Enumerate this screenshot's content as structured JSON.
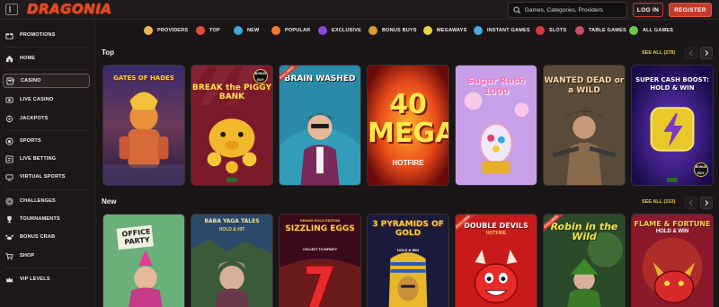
{
  "header": {
    "logo": "DRAGONIA",
    "search_placeholder": "Games, Categories, Providers",
    "login_label": "LOG IN",
    "register_label": "REGISTER"
  },
  "sidebar": {
    "items": [
      {
        "label": "PROMOTIONS",
        "icon": "gift-icon"
      },
      {
        "label": "HOME",
        "icon": "home-icon"
      },
      {
        "label": "CASINO",
        "icon": "slot-machine-icon",
        "active": true
      },
      {
        "label": "LIVE CASINO",
        "icon": "live-casino-icon"
      },
      {
        "label": "JACKPOTS",
        "icon": "jackpot-icon"
      },
      {
        "label": "SPORTS",
        "icon": "soccer-ball-icon"
      },
      {
        "label": "LIVE BETTING",
        "icon": "live-betting-icon"
      },
      {
        "label": "VIRTUAL SPORTS",
        "icon": "virtual-sports-icon"
      },
      {
        "label": "CHALLENGES",
        "icon": "target-icon"
      },
      {
        "label": "TOURNAMENTS",
        "icon": "trophy-icon"
      },
      {
        "label": "BONUS CRAB",
        "icon": "crab-icon"
      },
      {
        "label": "SHOP",
        "icon": "cart-icon"
      },
      {
        "label": "VIP LEVELS",
        "icon": "crown-icon"
      }
    ]
  },
  "categories": [
    {
      "label": "PROVIDERS",
      "color": "#e8b84a"
    },
    {
      "label": "TOP",
      "color": "#e84a3a"
    },
    {
      "label": "NEW",
      "color": "#3aa8d8"
    },
    {
      "label": "POPULAR",
      "color": "#f07a2a"
    },
    {
      "label": "EXCLUSIVE",
      "color": "#8a4ad8"
    },
    {
      "label": "BONUS BUYS",
      "color": "#d8a02a"
    },
    {
      "label": "MEGAWAYS",
      "color": "#e8d04a"
    },
    {
      "label": "INSTANT GAMES",
      "color": "#4aa8e8"
    },
    {
      "label": "SLOTS",
      "color": "#d83a3a"
    },
    {
      "label": "TABLE GAMES",
      "color": "#c84a6a"
    },
    {
      "label": "ALL GAMES",
      "color": "#6ac84a"
    }
  ],
  "sections": {
    "top": {
      "title": "Top",
      "see_all": "SEE ALL (278)",
      "games": [
        {
          "name": "GATES OF HADES",
          "ribbon": ""
        },
        {
          "name": "BREAK the PIGGY BANK",
          "ribbon": "",
          "badge": "BONUS BUY"
        },
        {
          "name": "BRAIN WASHED",
          "ribbon": "EXCLUSIVE"
        },
        {
          "name": "40 MEGA",
          "subtitle": "HOTFIRE",
          "ribbon": ""
        },
        {
          "name": "Sugar Rush 1000",
          "ribbon": ""
        },
        {
          "name": "WANTED DEAD or a WILD",
          "ribbon": ""
        },
        {
          "name": "SUPER CASH BOOST: HOLD & WIN",
          "ribbon": "",
          "badge": "BONUS BUY"
        }
      ]
    },
    "new": {
      "title": "New",
      "see_all": "SEE ALL (153)",
      "games": [
        {
          "name": "OFFICE PARTY",
          "ribbon": ""
        },
        {
          "name": "BABA YAGA TALES",
          "subtitle": "HOLD & HIT",
          "ribbon": ""
        },
        {
          "name": "SIZZLING EGGS",
          "subtitle": "COLLECT TO INFINITY",
          "tag": "GRAND GOLD EDITION",
          "ribbon": ""
        },
        {
          "name": "3 PYRAMIDS OF GOLD",
          "subtitle": "HOLD & WIN",
          "ribbon": ""
        },
        {
          "name": "DOUBLE DEVILS",
          "subtitle": "HOTFIRE",
          "ribbon": "EXCLUSIVE"
        },
        {
          "name": "Robin in the Wild",
          "ribbon": "EXCLUSIVE"
        },
        {
          "name": "FLAME & FORTUNE",
          "subtitle": "HOLD & WIN",
          "ribbon": ""
        }
      ]
    }
  }
}
